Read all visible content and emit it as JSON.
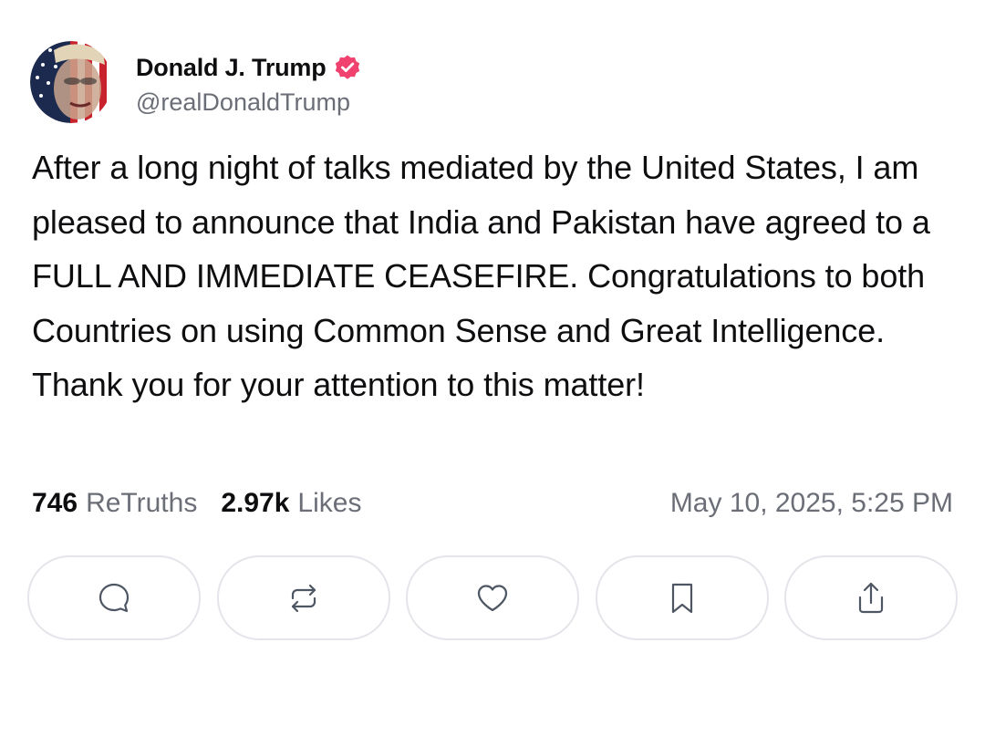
{
  "author": {
    "display_name": "Donald J. Trump",
    "handle": "@realDonaldTrump",
    "verified": true,
    "verified_icon": "verified-badge-icon",
    "avatar_icon": "profile-avatar"
  },
  "post": {
    "text": "After a long night of talks mediated by the United States, I am pleased to announce that India and Pakistan have agreed to a FULL AND IMMEDIATE CEASEFIRE. Congratulations to both Countries on using Common Sense and Great Intelligence. Thank you for your attention to this matter!",
    "retruths_count": "746",
    "retruths_label": "ReTruths",
    "likes_count": "2.97k",
    "likes_label": "Likes",
    "timestamp": "May 10, 2025, 5:25 PM"
  },
  "actions": [
    {
      "name": "reply",
      "icon": "reply-icon"
    },
    {
      "name": "retruth",
      "icon": "repost-icon"
    },
    {
      "name": "like",
      "icon": "heart-icon"
    },
    {
      "name": "bookmark",
      "icon": "bookmark-icon"
    },
    {
      "name": "share",
      "icon": "share-icon"
    }
  ],
  "colors": {
    "verified_badge": "#f0416f",
    "primary_text": "#0e0e10",
    "secondary_text": "#6b6e77",
    "button_border": "#e4e5ea",
    "icon_stroke": "#4f5663"
  }
}
